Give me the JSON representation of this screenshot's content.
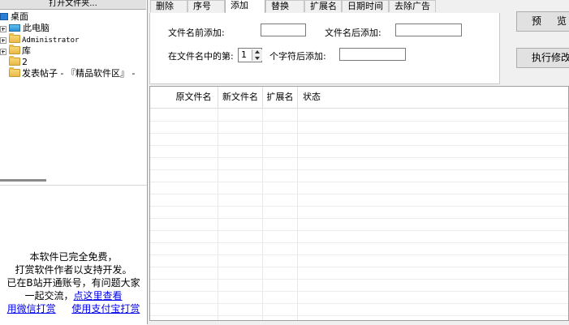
{
  "left": {
    "open_folder_label": "打开文件夹...",
    "tree": [
      {
        "label": "桌面",
        "icon": "desktop-icon"
      },
      {
        "label": "此电脑",
        "icon": "computer-icon"
      },
      {
        "label": "Administrator",
        "icon": "folder-icon"
      },
      {
        "label": "库",
        "icon": "folder-icon"
      },
      {
        "label": "2",
        "icon": "folder-icon"
      },
      {
        "label": "发表帖子 - 『精品软件区』 -",
        "icon": "folder-icon"
      }
    ],
    "info": {
      "line1": "本软件已完全免费，",
      "line2": "打赏软件作者以支持开发。",
      "line3": "已在B站开通账号，有问题大家",
      "line4_prefix": "一起交流，",
      "line4_link": "点这里查看",
      "wechat_link": "用微信打赏",
      "alipay_link": "使用支付宝打赏"
    }
  },
  "tabs": [
    "删除",
    "序号",
    "添加",
    "替换",
    "扩展名",
    "日期时间",
    "去除广告"
  ],
  "active_tab": "添加",
  "add_tab": {
    "prefix_label": "文件名前添加:",
    "prefix_value": "",
    "suffix_label": "文件名后添加:",
    "suffix_value": "",
    "position_label": "在文件名中的第:",
    "position_value": "1",
    "after_chars_label": "个字符后添加:",
    "after_chars_value": ""
  },
  "buttons": {
    "preview": "预览",
    "execute": "执行修改"
  },
  "grid": {
    "columns": [
      "原文件名",
      "新文件名",
      "扩展名",
      "状态"
    ],
    "rows": []
  }
}
